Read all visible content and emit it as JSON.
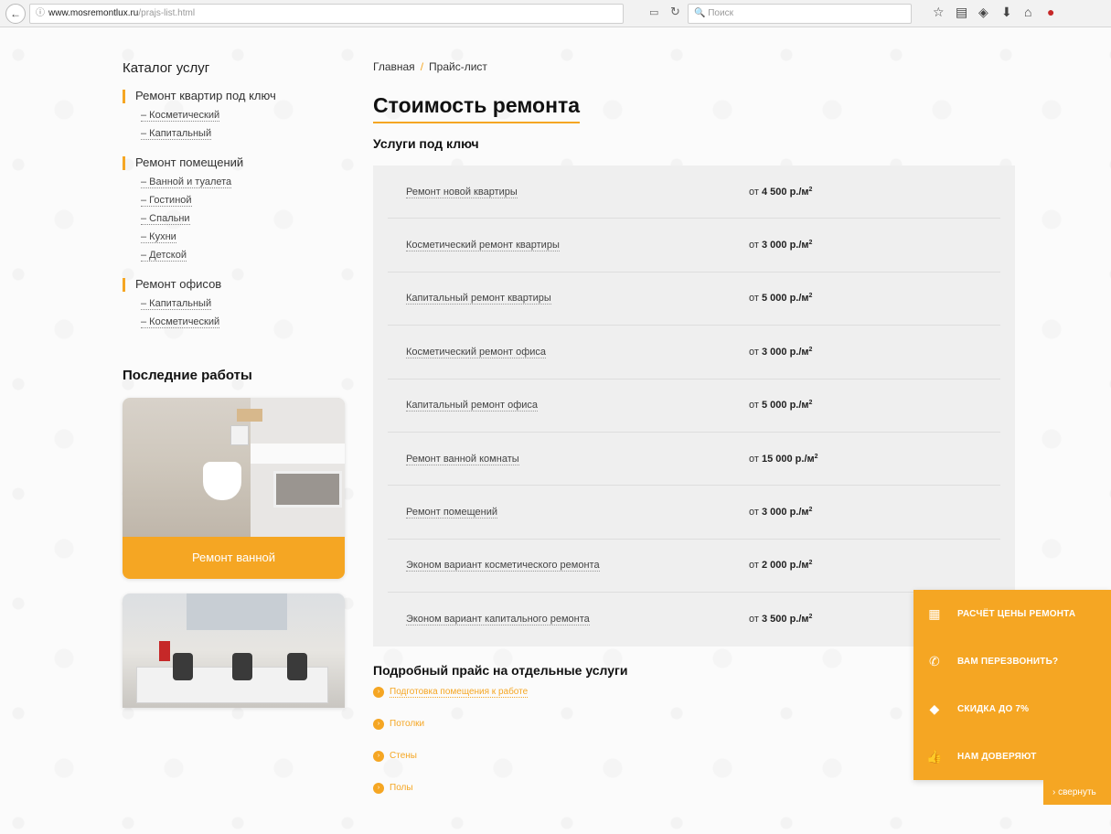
{
  "browser": {
    "url_host": "www.mosremontlux.ru",
    "url_path": "/prajs-list.html",
    "search_placeholder": "Поиск",
    "back_icon": "←",
    "info_icon": "ⓘ",
    "reader_icon": "▭",
    "reload_icon": "↻",
    "search_icon": "🔍",
    "toolbar_icons": [
      "☆",
      "▤",
      "◈",
      "⬇",
      "⌂",
      "●"
    ]
  },
  "sidebar": {
    "catalog_heading": "Каталог услуг",
    "groups": [
      {
        "title": "Ремонт квартир под ключ",
        "items": [
          "– Косметический",
          "– Капитальный"
        ]
      },
      {
        "title": "Ремонт помещений",
        "items": [
          "– Ванной и туалета",
          "– Гостиной",
          "– Спальни",
          "– Кухни",
          "– Детской"
        ]
      },
      {
        "title": "Ремонт офисов",
        "items": [
          "– Капитальный",
          "– Косметический"
        ]
      }
    ],
    "works_heading": "Последние работы",
    "work_cards": [
      {
        "label": "Ремонт ванной"
      },
      {
        "label": ""
      }
    ]
  },
  "main": {
    "breadcrumb": {
      "home": "Главная",
      "separator": "/",
      "current": "Прайс-лист"
    },
    "title": "Стоимость ремонта",
    "turnkey_heading": "Услуги под ключ",
    "prices": [
      {
        "name": "Ремонт новой квартиры",
        "prefix": "от",
        "amount": "4 500 р./м",
        "sup": "2"
      },
      {
        "name": "Косметический ремонт квартиры",
        "prefix": "от",
        "amount": "3 000 р./м",
        "sup": "2"
      },
      {
        "name": "Капитальный ремонт квартиры",
        "prefix": "от",
        "amount": "5 000 р./м",
        "sup": "2"
      },
      {
        "name": "Косметический ремонт офиса",
        "prefix": "от",
        "amount": "3 000 р./м",
        "sup": "2"
      },
      {
        "name": "Капитальный ремонт офиса",
        "prefix": "от",
        "amount": "5 000 р./м",
        "sup": "2"
      },
      {
        "name": "Ремонт ванной комнаты",
        "prefix": "от",
        "amount": "15 000 р./м",
        "sup": "2"
      },
      {
        "name": "Ремонт помещений",
        "prefix": "от",
        "amount": "3 000 р./м",
        "sup": "2"
      },
      {
        "name": "Эконом вариант косметического ремонта",
        "prefix": "от",
        "amount": "2 000 р./м",
        "sup": "2"
      },
      {
        "name": "Эконом вариант капитального ремонта",
        "prefix": "от",
        "amount": "3 500 р./м",
        "sup": "2"
      }
    ],
    "detail_heading": "Подробный прайс на отдельные услуги",
    "detail_items": [
      "Подготовка помещения к работе",
      "Потолки",
      "Стены",
      "Полы"
    ]
  },
  "float_panel": {
    "items": [
      {
        "icon": "calculator-icon",
        "glyph": "▦",
        "label": "РАСЧЁТ ЦЕНЫ РЕМОНТА"
      },
      {
        "icon": "phone-icon",
        "glyph": "✆",
        "label": "ВАМ ПЕРЕЗВОНИТЬ?"
      },
      {
        "icon": "tag-icon",
        "glyph": "◆",
        "label": "СКИДКА ДО 7%"
      },
      {
        "icon": "thumbs-up-icon",
        "glyph": "👍",
        "label": "НАМ ДОВЕРЯЮТ"
      }
    ],
    "collapse_label": "› свернуть"
  },
  "colors": {
    "accent": "#f5a623",
    "price_box_bg": "#efefef"
  }
}
